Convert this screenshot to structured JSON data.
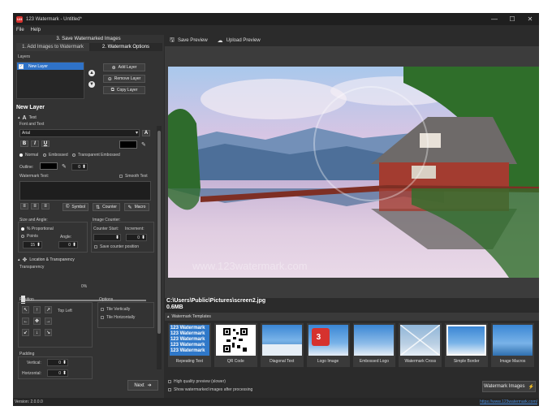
{
  "window": {
    "title": "123 Watermark - Untitled*",
    "logo_text": "123",
    "minimize": "—",
    "maximize": "☐",
    "close": "✕"
  },
  "menu": [
    "File",
    "Help"
  ],
  "left_panel": {
    "step_title": "3. Save Watermarked Images",
    "tabs": [
      "1. Add Images to Watermark",
      "2. Watermark Options"
    ],
    "layers_label": "Layers",
    "layers": [
      {
        "name": "New Layer",
        "checked": true
      }
    ],
    "add_layer": "Add Layer",
    "remove_layer": "Remove Layer",
    "copy_layer": "Copy Layer",
    "layer_heading": "New Layer",
    "text_section": "Text",
    "font_label": "Font and Text",
    "font_value": "Arial",
    "format_bold": "B",
    "format_italic": "I",
    "format_underline": "U",
    "text_styles": [
      "Normal",
      "Embossed",
      "Transparent Embossed"
    ],
    "outline_label": "Outline:",
    "outline_value": "0",
    "watermark_text_label": "Watermark Text:",
    "smooth_text": "Smooth Text",
    "symbol_btn": "Symbol",
    "counter_btn": "Counter",
    "macro_btn": "Macro",
    "size_angle_label": "Size and Angle:",
    "size_options": [
      "% Proportional",
      "Points"
    ],
    "angle_label": "Angle:",
    "size_value": "15",
    "angle_value": "0",
    "image_counter_label": "Image Counter:",
    "counter_start_label": "Counter Start:",
    "increment_label": "Increment:",
    "counter_start_value": "",
    "increment_value": "0",
    "save_counter": "Save counter position",
    "location_section": "Location & Transparency",
    "transparency_label": "Transparency",
    "transparency_value": "0%",
    "transparency_fraction": 0.0,
    "position_label": "Position",
    "position_value": "Top Left",
    "options_label": "Options",
    "tile_vertically": "Tile Vertically",
    "tile_horizontally": "Tile Horizontally",
    "padding_label": "Padding",
    "vertical_label": "Vertical:",
    "vertical_value": "0",
    "horizontal_label": "Horizontal:",
    "horizontal_value": "0",
    "next_btn": "Next"
  },
  "toolbar": {
    "save_preview": "Save Preview",
    "upload_preview": "Upload Preview"
  },
  "preview": {
    "watermark_text": "www.123watermark.com",
    "file_path": "C:\\Users\\Public\\Pictures\\screen2.jpg",
    "file_size": "0.6MB"
  },
  "templates": {
    "bar_label": "Watermark Templates",
    "items": [
      "Repeating Text",
      "QR Code",
      "Diagonal Text",
      "Logo Image",
      "Embossed Logo",
      "Watermark Cross",
      "Simple Border",
      "Image Macros"
    ]
  },
  "bottom_options": {
    "high_quality": "High quality preview (slower)",
    "show_after": "Show watermarked images after processing",
    "watermark_images_btn": "Watermark Images"
  },
  "status": {
    "version": "Version: 2.0.0.0",
    "url": "https://www.123watermark.com/"
  }
}
